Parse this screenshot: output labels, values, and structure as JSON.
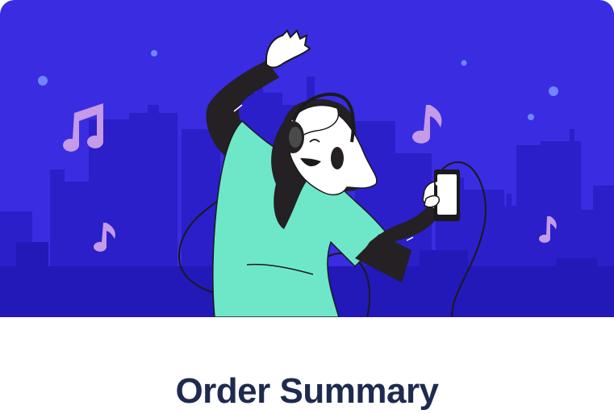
{
  "card": {
    "title": "Order Summary"
  },
  "hero": {
    "illustration": "person-dancing-with-headphones-and-phone",
    "icons": [
      "music-note-icon",
      "city-skyline",
      "headphones-icon",
      "phone-icon"
    ]
  },
  "colors": {
    "hero_background": "#3a2ce0",
    "skyline": "#2a1fc8",
    "skyline_light": "#4a3fe6",
    "shirt": "#6ee7c9",
    "music_note": "#c59ae8",
    "title_text": "#1f2a4f",
    "star": "#6f86ff"
  }
}
